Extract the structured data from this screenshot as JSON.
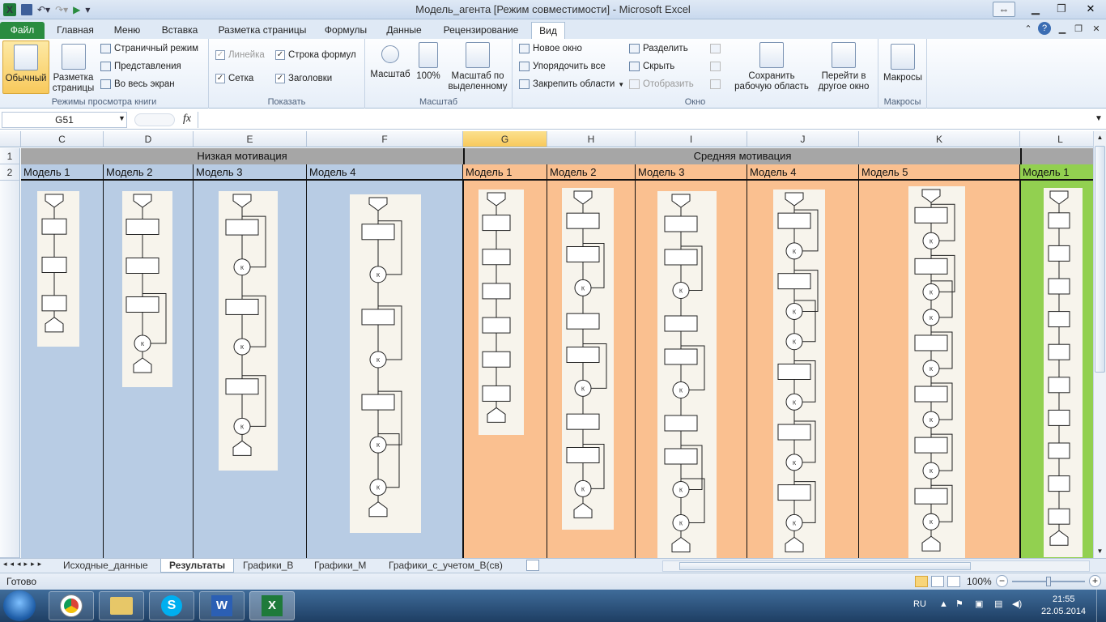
{
  "window": {
    "title": "Модель_агента  [Режим совместимости]  -  Microsoft Excel",
    "controls": [
      "minimize",
      "restore",
      "close"
    ]
  },
  "ribbon_tabs": {
    "file": "Файл",
    "items": [
      "Главная",
      "Меню",
      "Вставка",
      "Разметка страницы",
      "Формулы",
      "Данные",
      "Рецензирование",
      "Вид"
    ],
    "active": "Вид"
  },
  "ribbon": {
    "views": {
      "label": "Режимы просмотра книги",
      "normal": "Обычный",
      "page_layout_1": "Разметка",
      "page_layout_2": "страницы",
      "page_break": "Страничный режим",
      "custom_views": "Представления",
      "full_screen": "Во весь экран"
    },
    "show": {
      "label": "Показать",
      "ruler": "Линейка",
      "formula_bar": "Строка формул",
      "gridlines": "Сетка",
      "headings": "Заголовки"
    },
    "zoom": {
      "label": "Масштаб",
      "zoom": "Масштаб",
      "hundred": "100%",
      "to_selection_1": "Масштаб по",
      "to_selection_2": "выделенному"
    },
    "window": {
      "label": "Окно",
      "new_window": "Новое окно",
      "arrange_all": "Упорядочить все",
      "freeze_panes": "Закрепить области",
      "split": "Разделить",
      "hide": "Скрыть",
      "unhide": "Отобразить",
      "save_workspace_1": "Сохранить",
      "save_workspace_2": "рабочую область",
      "switch_windows_1": "Перейти в",
      "switch_windows_2": "другое окно"
    },
    "macros": {
      "label": "Макросы",
      "macros": "Макросы"
    }
  },
  "formula_bar": {
    "name_box": "G51",
    "fx": "fx",
    "formula": ""
  },
  "grid": {
    "columns": [
      "C",
      "D",
      "E",
      "F",
      "G",
      "H",
      "I",
      "J",
      "K",
      "L"
    ],
    "selected_column": "G",
    "rows": [
      "1",
      "2"
    ],
    "groups": [
      {
        "name": "Низкая мотивация",
        "color": "#b8cce4"
      },
      {
        "name": "Средняя мотивация",
        "color": "#fac090"
      },
      {
        "name": "",
        "color": "#92d050"
      }
    ],
    "models": [
      "Модель 1",
      "Модель 2",
      "Модель 3",
      "Модель 4",
      "Модель 1",
      "Модель 2",
      "Модель 3",
      "Модель 4",
      "Модель 5",
      "Модель 1"
    ],
    "flow_label": "К"
  },
  "sheet_tabs": {
    "items": [
      "Исходные_данные",
      "Результаты",
      "Графики_В",
      "Графики_М",
      "Графики_с_учетом_В(св)"
    ],
    "active": "Результаты"
  },
  "status": {
    "ready": "Готово",
    "zoom": "100%"
  },
  "taskbar": {
    "apps": [
      "start",
      "chrome",
      "explorer",
      "skype",
      "word",
      "excel"
    ],
    "lang": "RU",
    "time": "21:55",
    "date": "22.05.2014"
  }
}
